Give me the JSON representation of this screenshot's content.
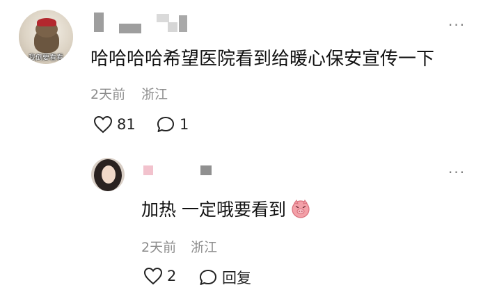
{
  "comment": {
    "avatar_caption": "我倒要看看",
    "content": "哈哈哈哈希望医院看到给暖心保安宣传一下",
    "time": "2天前",
    "location": "浙江",
    "likes": "81",
    "replies": "1",
    "more_glyph": "···"
  },
  "reply": {
    "content": "加热 一定哦要看到",
    "emoji": "pig-emoji",
    "time": "2天前",
    "location": "浙江",
    "likes": "2",
    "reply_label": "回复",
    "more_glyph": "···"
  },
  "colors": {
    "text": "#111111",
    "meta": "#8c8c8c",
    "icon": "#222222",
    "pig": "#f3a0a8"
  }
}
